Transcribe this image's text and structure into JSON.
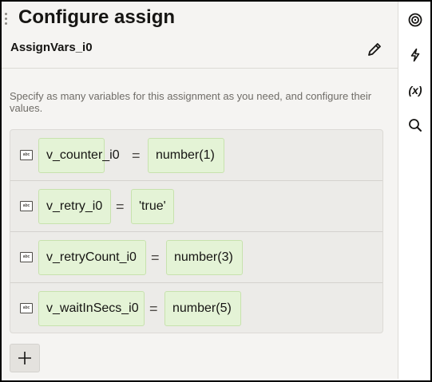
{
  "panel": {
    "title": "Configure assign",
    "subtitle": "AssignVars_i0",
    "description": "Specify as many variables for this assignment as you need, and configure their values."
  },
  "assignments": [
    {
      "type_icon": "abc",
      "variable": "v_counter_i0",
      "operator": "=",
      "value": "number(1)"
    },
    {
      "type_icon": "abc",
      "variable": "v_retry_i0",
      "operator": "=",
      "value": "'true'"
    },
    {
      "type_icon": "abc",
      "variable": "v_retryCount_i0",
      "operator": "=",
      "value": "number(3)"
    },
    {
      "type_icon": "abc",
      "variable": "v_waitInSecs_i0",
      "operator": "=",
      "value": "number(5)"
    }
  ],
  "toolbar": {
    "edit_icon": "pencil-icon",
    "add_icon": "plus-icon"
  },
  "rail": {
    "items": [
      {
        "icon": "target-icon"
      },
      {
        "icon": "lightning-icon"
      },
      {
        "icon": "variable-icon",
        "label": "(x)"
      },
      {
        "icon": "search-icon"
      }
    ]
  },
  "colors": {
    "panel_bg": "#f5f4f2",
    "chip_bg": "#e4f3d6",
    "chip_border": "#c7e2ad",
    "text": "#161513",
    "muted_text": "#6f6c67"
  }
}
